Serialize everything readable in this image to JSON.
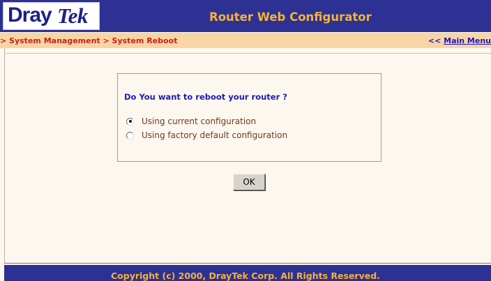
{
  "header": {
    "logo_part1": "Dray",
    "logo_part2": "Tek",
    "title": "Router Web Configurator",
    "bg_color": "#2d3193",
    "title_color": "#f5b237"
  },
  "breadcrumb": {
    "text": "> System Management > System Reboot",
    "color": "#c81e1e",
    "bar_color": "#f9d5a4"
  },
  "main_menu": {
    "prefix": "<< ",
    "link_label": "Main Menu"
  },
  "dialog": {
    "question": "Do You want to reboot your router ?",
    "options": [
      {
        "label": "Using current configuration",
        "checked": true
      },
      {
        "label": "Using factory default configuration",
        "checked": false
      }
    ]
  },
  "ok_button": {
    "label": "OK"
  },
  "footer": {
    "copyright": "Copyright (c) 2000, DrayTek Corp. All Rights Reserved."
  }
}
